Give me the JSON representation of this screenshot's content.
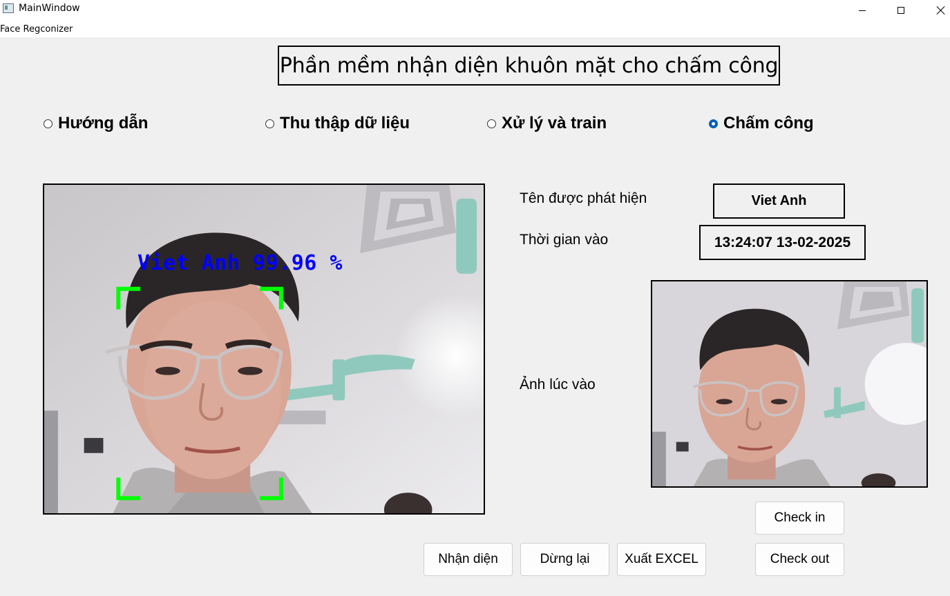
{
  "window": {
    "title": "MainWindow"
  },
  "menu": {
    "item": "Face Regconizer"
  },
  "heading": "Phần mềm nhận diện khuôn mặt cho chấm công",
  "tabs": [
    {
      "label": "Hướng dẫn",
      "checked": false
    },
    {
      "label": "Thu thập dữ liệu",
      "checked": false
    },
    {
      "label": "Xử lý và train",
      "checked": false
    },
    {
      "label": "Chấm công",
      "checked": true
    }
  ],
  "camera": {
    "overlay_text": "Viet Anh 99.96 %",
    "overlay_color": "#0000ff",
    "box_color": "#00ff00"
  },
  "info": {
    "name_label": "Tên được phát hiện",
    "name_value": "Viet Anh",
    "time_label": "Thời gian vào",
    "time_value": "13:24:07 13-02-2025",
    "photo_label": "Ảnh lúc vào"
  },
  "buttons": {
    "recognize": "Nhận diện",
    "stop": "Dừng lại",
    "export": "Xuất EXCEL",
    "check_in": "Check in",
    "check_out": "Check out"
  },
  "colors": {
    "radio_accent": "#005fb8"
  }
}
